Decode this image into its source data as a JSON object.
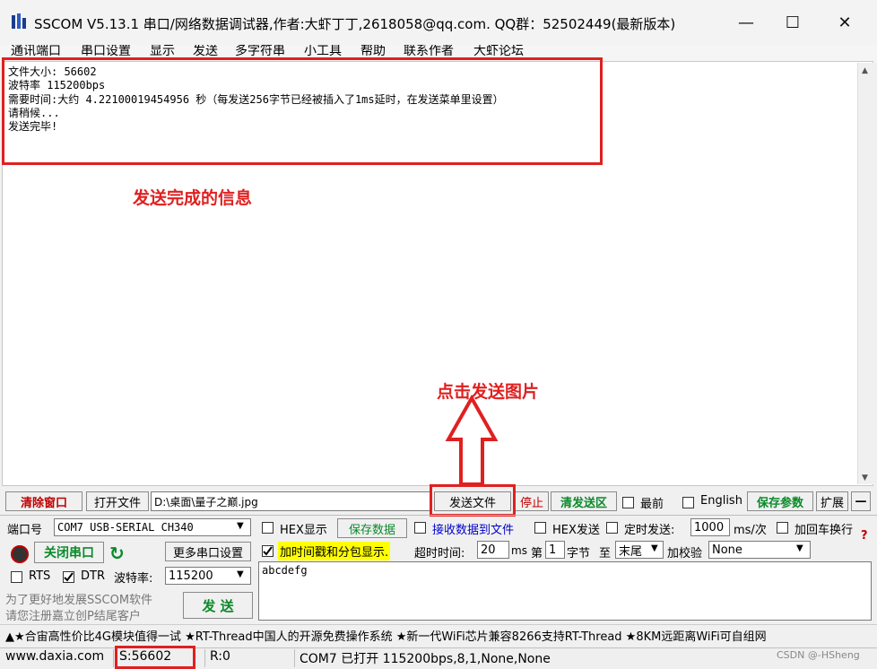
{
  "window": {
    "title": "SSCOM V5.13.1 串口/网络数据调试器,作者:大虾丁丁,2618058@qq.com. QQ群：52502449(最新版本)",
    "minimize": "—",
    "maximize": "☐",
    "close": "✕"
  },
  "menu": [
    "通讯端口",
    "串口设置",
    "显示",
    "发送",
    "多字符串",
    "小工具",
    "帮助",
    "联系作者",
    "大虾论坛"
  ],
  "output": {
    "lines": [
      "文件大小: 56602",
      "波特率 115200bps",
      "需要时间:大约 4.22100019454956 秒（每发送256字节已经被插入了1ms延时，在发送菜单里设置）",
      "请稍候...",
      "发送完毕!"
    ]
  },
  "annotations": {
    "done_info": "发送完成的信息",
    "click_send": "点击发送图片"
  },
  "toolbar1": {
    "clear_window": "清除窗口",
    "open_file": "打开文件",
    "file_path": "D:\\桌面\\量子之巅.jpg",
    "send_file": "发送文件",
    "stop": "停止",
    "clear_send": "清发送区",
    "topmost": "最前",
    "english": "English",
    "save_params": "保存参数",
    "expand": "扩展",
    "collapse": "—"
  },
  "port": {
    "port_label": "端口号",
    "port_value": "COM7 USB-SERIAL CH340",
    "close_port": "关闭串口",
    "more_settings": "更多串口设置",
    "rts": "RTS",
    "dtr": "DTR",
    "baud_label": "波特率:",
    "baud_value": "115200"
  },
  "options1": {
    "hex_display": "HEX显示",
    "save_data": "保存数据",
    "recv_to_file": "接收数据到文件",
    "hex_send": "HEX发送",
    "timed_send": "定时发送:",
    "interval": "1000",
    "interval_unit": "ms/次",
    "append_newline": "加回车换行"
  },
  "options2": {
    "timestamp": "加时间戳和分包显示.",
    "timeout_label": "超时时间:",
    "timeout_value": "20",
    "timeout_unit": "ms",
    "nth_label": "第",
    "nth_value": "1",
    "byte_label": "字节",
    "to_label": "至",
    "to_value": "末尾",
    "checksum_label": "加校验",
    "checksum_value": "None",
    "q": "?"
  },
  "send_area": {
    "text": "abcdefg",
    "send_button": "发 送",
    "promo1": "为了更好地发展SSCOM软件",
    "promo2": "请您注册嘉立创P结尾客户"
  },
  "ticker": "▲★合宙高性价比4G模块值得一试 ★RT-Thread中国人的开源免费操作系统 ★新一代WiFi芯片兼容8266支持RT-Thread ★8KM远距离WiFi可自组网",
  "status": {
    "site": "www.daxia.com",
    "sent": "S:56602",
    "recv": "R:0",
    "port_state": "COM7 已打开  115200bps,8,1,None,None",
    "watermark": "CSDN @-HSheng"
  },
  "colors": {
    "annotation_red": "#e02020",
    "button_green": "#0a8a2a",
    "highlight_yellow": "#ffff00",
    "link_blue": "#0000cc"
  }
}
